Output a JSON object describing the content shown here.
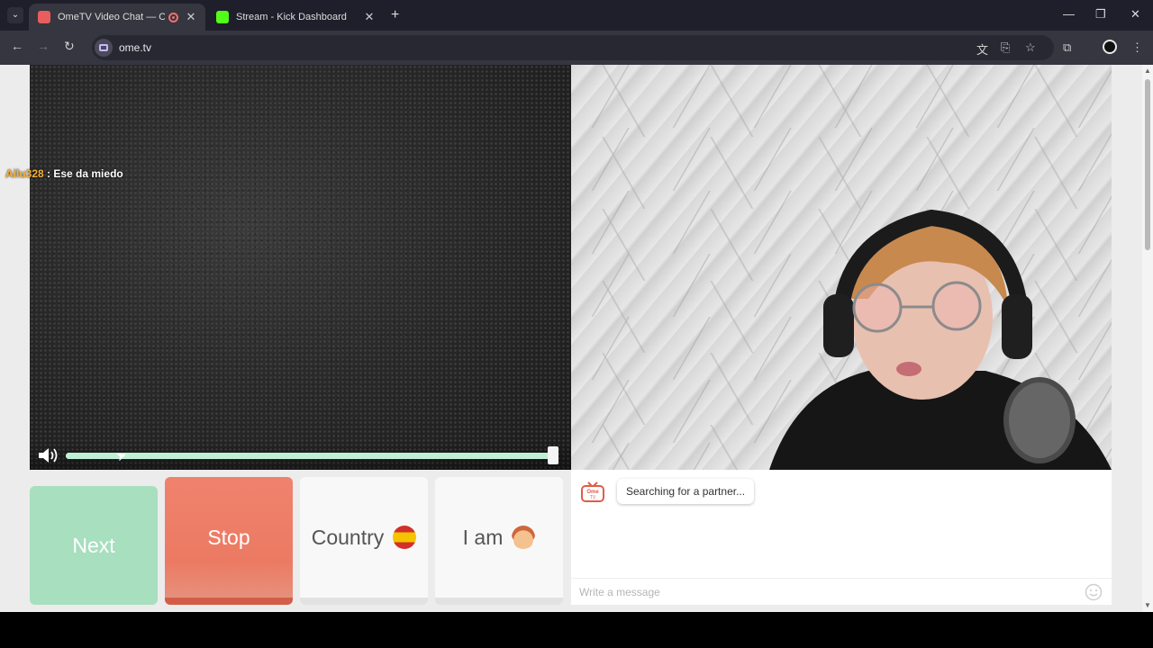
{
  "browser": {
    "tabs": [
      {
        "title": "OmeTV Video Chat — Ome",
        "active": true
      },
      {
        "title": "Stream - Kick Dashboard",
        "active": false
      }
    ],
    "url": "ome.tv"
  },
  "video": {
    "chat_overlay": {
      "user": "Ailu328",
      "message": ": Ese da miedo"
    },
    "volume": 1.0
  },
  "controls": {
    "next_label": "Next",
    "stop_label": "Stop",
    "country_label": "Country",
    "iam_label": "I am"
  },
  "chat": {
    "status": "Searching for a partner...",
    "placeholder": "Write a message",
    "logo_text": "Ome TV"
  },
  "colors": {
    "next": "#a7dfbf",
    "stop": "#ec7a63",
    "slider": "#c5efd9",
    "chat_username": "#f4b13c"
  }
}
